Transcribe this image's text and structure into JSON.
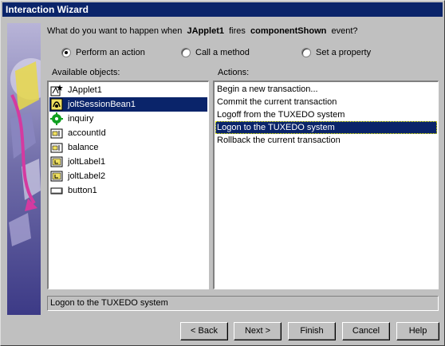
{
  "window": {
    "title": "Interaction Wizard"
  },
  "question": {
    "prefix": "What do you want to happen when",
    "source": "JApplet1",
    "middle": "fires",
    "event": "componentShown",
    "suffix": "event?"
  },
  "options": [
    {
      "label": "Perform an action",
      "selected": true
    },
    {
      "label": "Call a method",
      "selected": false
    },
    {
      "label": "Set a property",
      "selected": false
    }
  ],
  "objects": {
    "label": "Available objects:",
    "items": [
      {
        "label": "JApplet1",
        "icon": "applet-icon",
        "selected": false
      },
      {
        "label": "joltSessionBean1",
        "icon": "session-bean-icon",
        "selected": true
      },
      {
        "label": "inquiry",
        "icon": "gear-icon",
        "selected": false
      },
      {
        "label": "accountId",
        "icon": "text-field-icon",
        "selected": false
      },
      {
        "label": "balance",
        "icon": "text-field-icon",
        "selected": false
      },
      {
        "label": "joltLabel1",
        "icon": "label-icon",
        "selected": false
      },
      {
        "label": "joltLabel2",
        "icon": "label-icon",
        "selected": false
      },
      {
        "label": "button1",
        "icon": "button-icon",
        "selected": false
      }
    ]
  },
  "actions": {
    "label": "Actions:",
    "items": [
      {
        "label": "Begin a new transaction...",
        "selected": false
      },
      {
        "label": "Commit the current transaction",
        "selected": false
      },
      {
        "label": "Logoff from the TUXEDO system",
        "selected": false
      },
      {
        "label": "Logon to the TUXEDO system",
        "selected": true
      },
      {
        "label": "Rollback the current transaction",
        "selected": false
      }
    ]
  },
  "status": "Logon to the TUXEDO system",
  "buttons": {
    "back": "< Back",
    "next": "Next >",
    "finish": "Finish",
    "cancel": "Cancel",
    "help": "Help"
  },
  "colors": {
    "selection": "#0a246a",
    "face": "#c0c0c0"
  }
}
